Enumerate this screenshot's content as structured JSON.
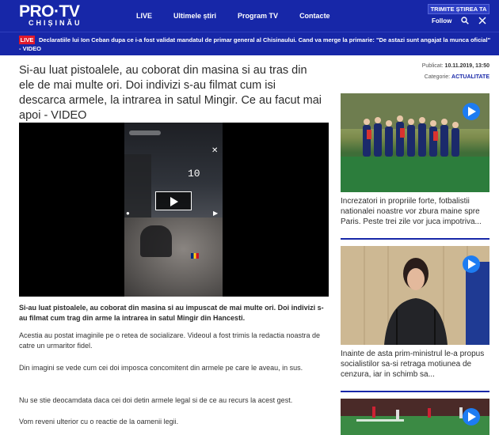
{
  "header": {
    "logo_main": "PRO·TV",
    "logo_sub": "CHIȘINĂU",
    "nav": [
      "LIVE",
      "Ultimele știri",
      "Program TV",
      "Contacte"
    ],
    "send_news": "TRIMITE ȘTIREA TA",
    "follow": "Follow",
    "colors": {
      "header_bg": "#1727a8",
      "live_red": "#e0192b",
      "play_blue": "#1d7cf2"
    }
  },
  "breaking": {
    "badge": "LIVE",
    "text": "Declaratiile lui Ion Ceban dupa ce i-a fost validat mandatul de primar general al Chisinaului. Cand va merge la primarie: \"De astazi sunt angajat la munca oficial\" - VIDEO"
  },
  "article": {
    "title": "Si-au luat pistoalele, au coborat din masina si au tras din ele de mai multe ori. Doi indivizi s-au filmat cum isi descarca armele, la intrarea in satul Mingir. Ce au facut mai apoi - VIDEO",
    "video_counter": "10",
    "lead": "Si-au luat pistoalele, au coborat din masina si au impuscat de mai multe ori. Doi indivizi s-au filmat cum trag din arme la intrarea in satul Mingir din Hancesti.",
    "paragraphs": [
      "Acestia au postat imaginile pe o retea de socializare. Videoul a fost trimis la redactia noastra de catre un urmaritor fidel.",
      "Din imagini se vede cum cei doi imposca concomitent din armele pe care le aveau, in sus.",
      "Nu se stie deocamdata daca cei doi detin armele legal si de ce au recurs la acest gest.",
      "Vom reveni ulterior cu o reactie de la oamenii legii."
    ]
  },
  "meta": {
    "published_label": "Publicat:",
    "published_value": "10.11.2019, 13:50",
    "category_label": "Categorie:",
    "category_value": "ACTUALITATE"
  },
  "sidebar": {
    "cards": [
      {
        "text": "Increzatori in propriile forte, fotbalistii nationalei noastre vor zbura maine spre Paris. Peste trei zile vor juca impotriva..."
      },
      {
        "text": "Inainte de asta prim-ministrul le-a propus socialistilor sa-si retraga motiunea de cenzura, iar in schimb sa..."
      },
      {
        "text": ""
      }
    ]
  }
}
